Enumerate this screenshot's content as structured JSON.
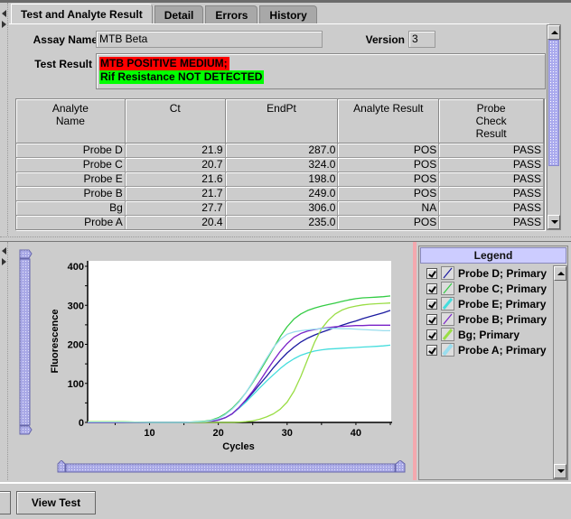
{
  "tabs": [
    {
      "label": "Test and Analyte Result",
      "active": true
    },
    {
      "label": "Detail",
      "active": false
    },
    {
      "label": "Errors",
      "active": false
    },
    {
      "label": "History",
      "active": false
    }
  ],
  "assay": {
    "name_label": "Assay Name",
    "name_value": "MTB Beta",
    "version_label": "Version",
    "version_value": "3"
  },
  "test_result": {
    "label": "Test Result",
    "lines": [
      {
        "text": "MTB POSITIVE MEDIUM;",
        "bg": "#ff0000"
      },
      {
        "text": "Rif Resistance NOT DETECTED",
        "bg": "#00ff00"
      }
    ]
  },
  "table": {
    "headers": [
      "Analyte\nName",
      "Ct",
      "EndPt",
      "Analyte Result",
      "Probe\nCheck\nResult"
    ],
    "rows": [
      [
        "Probe D",
        "21.9",
        "287.0",
        "POS",
        "PASS"
      ],
      [
        "Probe C",
        "20.7",
        "324.0",
        "POS",
        "PASS"
      ],
      [
        "Probe E",
        "21.6",
        "198.0",
        "POS",
        "PASS"
      ],
      [
        "Probe B",
        "21.7",
        "249.0",
        "POS",
        "PASS"
      ],
      [
        "Bg",
        "27.7",
        "306.0",
        "NA",
        "PASS"
      ],
      [
        "Probe A",
        "20.4",
        "235.0",
        "POS",
        "PASS"
      ]
    ]
  },
  "legend": {
    "title": "Legend",
    "items": [
      {
        "label": "Probe D; Primary",
        "color": "#1a1aa0",
        "checked": true
      },
      {
        "label": "Probe C; Primary",
        "color": "#33cc44",
        "checked": true
      },
      {
        "label": "Probe E; Primary",
        "color": "#44dddd",
        "checked": true
      },
      {
        "label": "Probe B; Primary",
        "color": "#7a22c8",
        "checked": true
      },
      {
        "label": "Bg; Primary",
        "color": "#99dd44",
        "checked": true
      },
      {
        "label": "Probe A; Primary",
        "color": "#99ddee",
        "checked": true
      }
    ]
  },
  "buttons": {
    "view_test": "View Test"
  },
  "chart_data": {
    "type": "line",
    "title": "",
    "xlabel": "Cycles",
    "ylabel": "Fluorescence",
    "xlim": [
      1,
      45
    ],
    "ylim": [
      0,
      400
    ],
    "xticks": [
      10,
      20,
      30,
      40
    ],
    "yticks": [
      0,
      100,
      200,
      300,
      400
    ],
    "grid": false,
    "x": [
      1,
      5,
      10,
      15,
      18,
      19,
      20,
      21,
      22,
      23,
      24,
      25,
      26,
      27,
      28,
      29,
      30,
      31,
      32,
      33,
      34,
      35,
      36,
      37,
      38,
      39,
      40,
      41,
      42,
      43,
      44,
      45
    ],
    "series": [
      {
        "name": "Probe D; Primary",
        "color": "#1a1aa0",
        "values": [
          0,
          0,
          0,
          0,
          1,
          3,
          6,
          12,
          22,
          38,
          56,
          76,
          97,
          118,
          140,
          160,
          178,
          193,
          206,
          216,
          224,
          231,
          237,
          243,
          249,
          255,
          260,
          266,
          271,
          276,
          281,
          287
        ]
      },
      {
        "name": "Probe C; Primary",
        "color": "#33cc44",
        "values": [
          2,
          2,
          0,
          0,
          3,
          6,
          12,
          22,
          36,
          54,
          76,
          102,
          130,
          160,
          190,
          220,
          245,
          265,
          278,
          287,
          293,
          298,
          302,
          306,
          310,
          314,
          317,
          319,
          320,
          321,
          322,
          324
        ]
      },
      {
        "name": "Probe E; Primary",
        "color": "#44dddd",
        "values": [
          1,
          1,
          0,
          0,
          1,
          3,
          6,
          12,
          22,
          36,
          52,
          70,
          88,
          106,
          122,
          138,
          152,
          163,
          172,
          178,
          183,
          186,
          188,
          189,
          190,
          191,
          192,
          193,
          194,
          195,
          196,
          198
        ]
      },
      {
        "name": "Probe B; Primary",
        "color": "#7a22c8",
        "values": [
          0,
          0,
          0,
          0,
          1,
          3,
          6,
          12,
          22,
          38,
          58,
          80,
          105,
          132,
          158,
          182,
          202,
          218,
          228,
          234,
          238,
          241,
          243,
          245,
          246,
          247,
          248,
          248,
          249,
          249,
          249,
          249
        ]
      },
      {
        "name": "Bg; Primary",
        "color": "#99dd44",
        "values": [
          2,
          2,
          0,
          0,
          0,
          0,
          0,
          0,
          0,
          1,
          2,
          4,
          8,
          14,
          22,
          34,
          52,
          80,
          118,
          162,
          206,
          240,
          262,
          278,
          288,
          294,
          298,
          301,
          303,
          304,
          305,
          306
        ]
      },
      {
        "name": "Probe A; Primary",
        "color": "#99ddee",
        "values": [
          1,
          1,
          0,
          0,
          2,
          5,
          10,
          20,
          34,
          52,
          76,
          104,
          134,
          164,
          192,
          212,
          226,
          232,
          235,
          237,
          239,
          240,
          241,
          241,
          240,
          240,
          239,
          238,
          237,
          236,
          235,
          235
        ]
      }
    ]
  }
}
